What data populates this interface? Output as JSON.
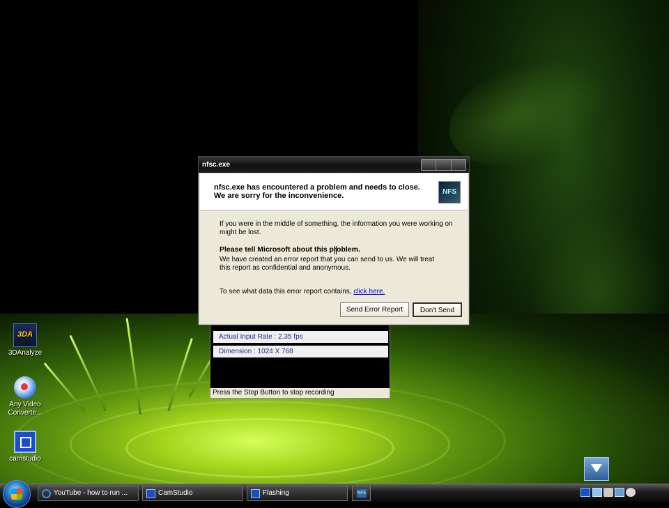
{
  "desktop": {
    "icons": [
      {
        "label": "3DAnalyze",
        "icon": "3danalyze-icon"
      },
      {
        "label": "Any Video Converte...",
        "icon": "any-video-converter-icon"
      },
      {
        "label": "camstudio",
        "icon": "camstudio-icon"
      }
    ]
  },
  "dialog": {
    "title": "nfsc.exe",
    "header_line1": "nfsc.exe has encountered a problem and needs to close.",
    "header_line2": "We are sorry for the inconvenience.",
    "app_logo_text": "NFS",
    "para1_line1": "If you were in the middle of something, the information you were working on",
    "para1_line2": "might be lost.",
    "bold_line": "Please tell Microsoft about this problem.",
    "para2_line1": "We have created an error report that you can send to us.  We will treat",
    "para2_line2": "this report as confidential and anonymous.",
    "see_data_text": "To see what data this error report contains,",
    "click_here": "click here.",
    "send_button": "Send Error Report",
    "dont_send_button": "Don't Send"
  },
  "camstudio_panel": {
    "rate": "Actual Input Rate  : 2.35 fps",
    "dimension": "Dimension  : 1024 X 768",
    "status": "Press the Stop Button to stop recording"
  },
  "taskbar": {
    "tasks": [
      {
        "label": "YouTube - how to run ...",
        "icon": "internet-explorer-icon"
      },
      {
        "label": "CamStudio",
        "icon": "camstudio-icon"
      },
      {
        "label": "Flashing",
        "icon": "camstudio-icon"
      }
    ],
    "quick_launch_icon": "nfs-game-icon",
    "tray_icons": [
      "camstudio-tray-icon",
      "network-icon",
      "speaker-icon",
      "display-icon",
      "volume-icon"
    ]
  },
  "colors": {
    "titlebar": "#101010",
    "dialog_bg": "#ece9d8",
    "link": "#0000cc",
    "cam_text": "#1a2a8a"
  }
}
